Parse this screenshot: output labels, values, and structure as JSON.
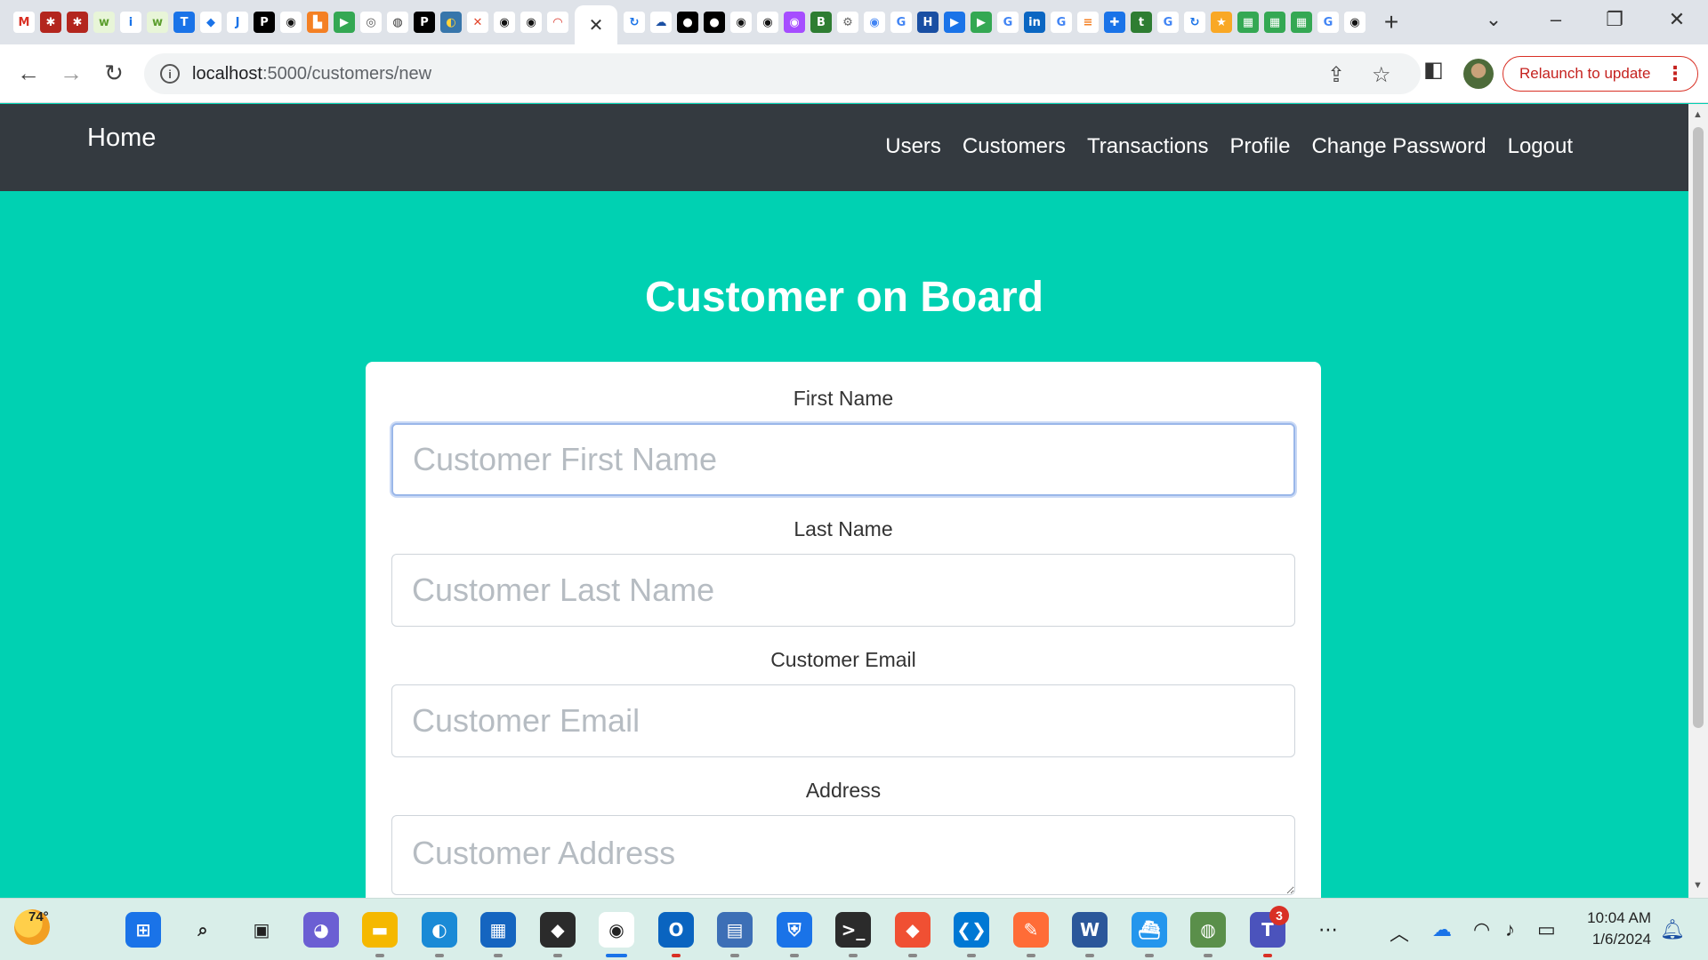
{
  "browser": {
    "favicons": [
      {
        "name": "gmail-icon",
        "glyph": "M",
        "color": "#ffffff",
        "text": "#d93025"
      },
      {
        "name": "app-icon-1",
        "glyph": "✱",
        "color": "#b3261e",
        "text": "#ffffff"
      },
      {
        "name": "app-icon-2",
        "glyph": "✱",
        "color": "#b3261e",
        "text": "#ffffff"
      },
      {
        "name": "app-icon-3",
        "glyph": "w",
        "color": "#e8f5d8",
        "text": "#5c9e2e"
      },
      {
        "name": "info-site-icon",
        "glyph": "i",
        "color": "#ffffff",
        "text": "#1a73e8"
      },
      {
        "name": "app-icon-4",
        "glyph": "w",
        "color": "#e8f5d8",
        "text": "#5c9e2e"
      },
      {
        "name": "t-icon",
        "glyph": "T",
        "color": "#1a73e8",
        "text": "#ffffff"
      },
      {
        "name": "diamond-icon",
        "glyph": "◆",
        "color": "#ffffff",
        "text": "#1a73e8"
      },
      {
        "name": "j2c-icon",
        "glyph": "J",
        "color": "#ffffff",
        "text": "#1a73e8"
      },
      {
        "name": "p-icon",
        "glyph": "P",
        "color": "#000000",
        "text": "#ffffff"
      },
      {
        "name": "github-icon",
        "glyph": "◉",
        "color": "#ffffff",
        "text": "#111111"
      },
      {
        "name": "orange-app-icon",
        "glyph": "▙",
        "color": "#f48024",
        "text": "#ffffff"
      },
      {
        "name": "meet-icon",
        "glyph": "▶",
        "color": "#34a853",
        "text": "#ffffff"
      },
      {
        "name": "chatgpt-icon",
        "glyph": "◎",
        "color": "#ffffff",
        "text": "#555555"
      },
      {
        "name": "globe-icon",
        "glyph": "◍",
        "color": "#ffffff",
        "text": "#333333"
      },
      {
        "name": "p-icon-2",
        "glyph": "P",
        "color": "#000000",
        "text": "#ffffff"
      },
      {
        "name": "python-icon",
        "glyph": "◐",
        "color": "#3776ab",
        "text": "#ffd43b"
      },
      {
        "name": "gitlab-icon",
        "glyph": "✕",
        "color": "#ffffff",
        "text": "#e24329"
      },
      {
        "name": "github-icon-2",
        "glyph": "◉",
        "color": "#ffffff",
        "text": "#111111"
      },
      {
        "name": "github-icon-3",
        "glyph": "◉",
        "color": "#ffffff",
        "text": "#111111"
      },
      {
        "name": "speed-icon",
        "glyph": "◠",
        "color": "#ffffff",
        "text": "#d93025"
      }
    ],
    "favicons_right": [
      {
        "name": "refresh-site-icon",
        "glyph": "↻",
        "color": "#ffffff",
        "text": "#1a73e8"
      },
      {
        "name": "cloud-icon",
        "glyph": "☁",
        "color": "#ffffff",
        "text": "#1a4fa3"
      },
      {
        "name": "medium-icon",
        "glyph": "●",
        "color": "#000000",
        "text": "#ffffff"
      },
      {
        "name": "medium-icon-2",
        "glyph": "●",
        "color": "#000000",
        "text": "#ffffff"
      },
      {
        "name": "github-icon-4",
        "glyph": "◉",
        "color": "#ffffff",
        "text": "#111111"
      },
      {
        "name": "github-icon-5",
        "glyph": "◉",
        "color": "#ffffff",
        "text": "#111111"
      },
      {
        "name": "chat-icon",
        "glyph": "◉",
        "color": "#a64dff",
        "text": "#ffffff"
      },
      {
        "name": "b64-icon",
        "glyph": "B",
        "color": "#2e7d32",
        "text": "#ffffff"
      },
      {
        "name": "gear-site-icon",
        "glyph": "⚙",
        "color": "#ffffff",
        "text": "#666666"
      },
      {
        "name": "maps-icon",
        "glyph": "◉",
        "color": "#ffffff",
        "text": "#4285f4"
      },
      {
        "name": "google-icon",
        "glyph": "G",
        "color": "#ffffff",
        "text": "#4285f4"
      },
      {
        "name": "hs-icon",
        "glyph": "H",
        "color": "#1a4fa3",
        "text": "#ffffff"
      },
      {
        "name": "video-icon",
        "glyph": "▶",
        "color": "#1a73e8",
        "text": "#ffffff"
      },
      {
        "name": "meet-icon-2",
        "glyph": "▶",
        "color": "#34a853",
        "text": "#ffffff"
      },
      {
        "name": "google-icon-2",
        "glyph": "G",
        "color": "#ffffff",
        "text": "#4285f4"
      },
      {
        "name": "linkedin-icon",
        "glyph": "in",
        "color": "#0a66c2",
        "text": "#ffffff"
      },
      {
        "name": "google-icon-3",
        "glyph": "G",
        "color": "#ffffff",
        "text": "#4285f4"
      },
      {
        "name": "stackoverflow-icon",
        "glyph": "≡",
        "color": "#ffffff",
        "text": "#f48024"
      },
      {
        "name": "puzzle-icon",
        "glyph": "✚",
        "color": "#1a73e8",
        "text": "#ffffff"
      },
      {
        "name": "tc-icon",
        "glyph": "t",
        "color": "#2e7d32",
        "text": "#ffffff"
      },
      {
        "name": "google-icon-4",
        "glyph": "G",
        "color": "#ffffff",
        "text": "#4285f4"
      },
      {
        "name": "refresh-site-icon-2",
        "glyph": "↻",
        "color": "#ffffff",
        "text": "#1a73e8"
      },
      {
        "name": "star-site-icon",
        "glyph": "★",
        "color": "#f9a825",
        "text": "#ffffff"
      },
      {
        "name": "sheets-icon",
        "glyph": "▦",
        "color": "#34a853",
        "text": "#ffffff"
      },
      {
        "name": "sheets-icon-2",
        "glyph": "▦",
        "color": "#34a853",
        "text": "#ffffff"
      },
      {
        "name": "sheets-icon-3",
        "glyph": "▦",
        "color": "#34a853",
        "text": "#ffffff"
      },
      {
        "name": "google-icon-5",
        "glyph": "G",
        "color": "#ffffff",
        "text": "#4285f4"
      },
      {
        "name": "github-icon-6",
        "glyph": "◉",
        "color": "#ffffff",
        "text": "#111111"
      }
    ],
    "active_tab_close": "✕",
    "new_tab": "+",
    "url_host": "localhost",
    "url_path": ":5000/customers/new",
    "relaunch_label": "Relaunch to update"
  },
  "navbar": {
    "brand": "Home",
    "links": [
      "Users",
      "Customers",
      "Transactions",
      "Profile",
      "Change Password",
      "Logout"
    ]
  },
  "page": {
    "title": "Customer on Board"
  },
  "form": {
    "first_name": {
      "label": "First Name",
      "placeholder": "Customer First Name",
      "value": ""
    },
    "last_name": {
      "label": "Last Name",
      "placeholder": "Customer Last Name",
      "value": ""
    },
    "email": {
      "label": "Customer Email",
      "placeholder": "Customer Email",
      "value": ""
    },
    "address": {
      "label": "Address",
      "placeholder": "Customer Address",
      "value": ""
    }
  },
  "taskbar": {
    "weather_temp": "74°",
    "time": "10:04 AM",
    "date": "1/6/2024",
    "teams_badge": "3",
    "apps": [
      {
        "name": "windows-start-icon",
        "glyph": "⊞",
        "color": "#1a73e8"
      },
      {
        "name": "search-icon",
        "glyph": "⌕",
        "color": "#d9eee9"
      },
      {
        "name": "task-view-icon",
        "glyph": "▣",
        "color": "#d9eee9"
      },
      {
        "name": "teams-chat-icon",
        "glyph": "◕",
        "color": "#6b5fd3"
      },
      {
        "name": "file-explorer-icon",
        "glyph": "▬",
        "color": "#f5b800"
      },
      {
        "name": "edge-icon",
        "glyph": "◐",
        "color": "#1a8ad6"
      },
      {
        "name": "store-icon",
        "glyph": "▦",
        "color": "#1565c0"
      },
      {
        "name": "git-bash-icon",
        "glyph": "◆",
        "color": "#2b2b2b"
      },
      {
        "name": "chrome-icon",
        "glyph": "◉",
        "color": "#ffffff"
      },
      {
        "name": "outlook-icon",
        "glyph": "O",
        "color": "#0a64c0"
      },
      {
        "name": "remote-desktop-icon",
        "glyph": "▤",
        "color": "#3d6fb6"
      },
      {
        "name": "defender-icon",
        "glyph": "⛨",
        "color": "#1a73e8"
      },
      {
        "name": "terminal-icon",
        "glyph": ">_",
        "color": "#2b2b2b"
      },
      {
        "name": "git-icon",
        "glyph": "◆",
        "color": "#f05033"
      },
      {
        "name": "vscode-icon",
        "glyph": "❮❯",
        "color": "#0078d4"
      },
      {
        "name": "postman-icon",
        "glyph": "✎",
        "color": "#ff6c37"
      },
      {
        "name": "word-icon",
        "glyph": "W",
        "color": "#2b579a"
      },
      {
        "name": "docker-icon",
        "glyph": "⛴",
        "color": "#2496ed"
      },
      {
        "name": "network-app-icon",
        "glyph": "◍",
        "color": "#5a8f4a"
      },
      {
        "name": "teams-icon",
        "glyph": "T",
        "color": "#4b53bc"
      }
    ]
  },
  "colors": {
    "page_bg": "#00d1b2",
    "navbar_bg": "#343a40",
    "focus_border": "#9ab7e9"
  }
}
